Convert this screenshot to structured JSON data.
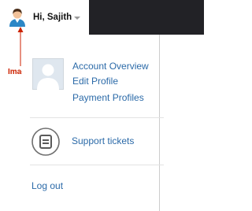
{
  "header": {
    "greeting": "Hi, Sajith",
    "user_icon": "user-avatar-icon",
    "caret_icon": "chevron-down-icon"
  },
  "annotation": {
    "label": "Image",
    "color": "#cc2200"
  },
  "menu": {
    "avatar_icon": "profile-placeholder-icon",
    "account_overview": "Account Overview",
    "edit_profile": "Edit Profile",
    "payment_profiles": "Payment Profiles",
    "support_icon": "ticket-icon",
    "support_tickets": "Support tickets",
    "logout": "Log out"
  },
  "colors": {
    "topbar": "#222226",
    "link": "#2b6aa8",
    "annotation": "#cc2200"
  }
}
